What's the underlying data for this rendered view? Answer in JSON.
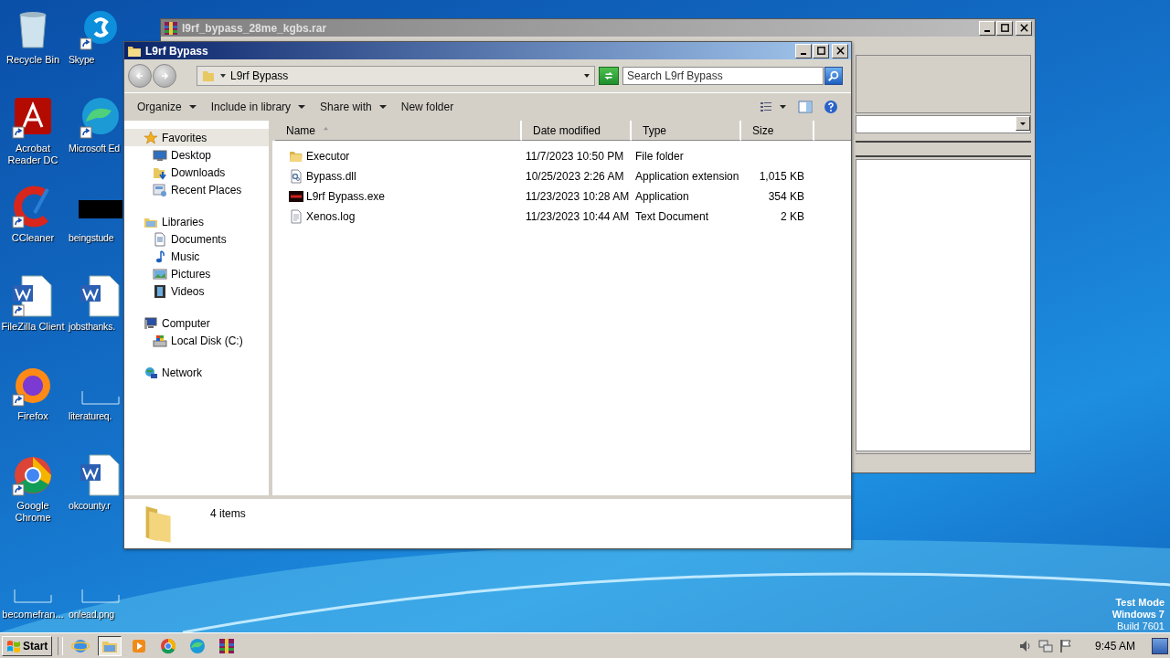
{
  "desktop": {
    "icons": [
      {
        "label": "Recycle Bin",
        "shortcut": false
      },
      {
        "label": "Skype",
        "shortcut": true
      },
      {
        "label": "Acrobat Reader DC",
        "shortcut": true
      },
      {
        "label": "Microsoft Ed",
        "shortcut": true
      },
      {
        "label": "CCleaner",
        "shortcut": true
      },
      {
        "label": "beingstude",
        "shortcut": false
      },
      {
        "label": "FileZilla Client",
        "shortcut": true
      },
      {
        "label": "jobsthanks.",
        "shortcut": false
      },
      {
        "label": "Firefox",
        "shortcut": true
      },
      {
        "label": "literatureq.",
        "shortcut": false
      },
      {
        "label": "Google Chrome",
        "shortcut": true
      },
      {
        "label": "okcounty.r",
        "shortcut": false
      },
      {
        "label": "becomefran...",
        "shortcut": false
      },
      {
        "label": "onlead.png",
        "shortcut": false
      }
    ],
    "watermark_lines": [
      "Test Mode",
      "Windows 7",
      "Build 7601"
    ]
  },
  "archive_window": {
    "title": "l9rf_bypass_28me_kgbs.rar",
    "active": false
  },
  "explorer_window": {
    "title": "L9rf Bypass",
    "active": true,
    "address": "L9rf Bypass",
    "search": {
      "placeholder": "Search L9rf Bypass"
    },
    "toolbar": [
      {
        "label": "Organize",
        "menu": true
      },
      {
        "label": "Include in library",
        "menu": true
      },
      {
        "label": "Share with",
        "menu": true
      },
      {
        "label": "New folder",
        "menu": false
      }
    ],
    "navigation": [
      {
        "label": "Favorites",
        "selected": true,
        "children": [
          {
            "label": "Desktop",
            "selected": false
          },
          {
            "label": "Downloads",
            "selected": false
          },
          {
            "label": "Recent Places",
            "selected": false
          }
        ]
      },
      {
        "label": "Libraries",
        "selected": false,
        "children": [
          {
            "label": "Documents",
            "selected": false
          },
          {
            "label": "Music",
            "selected": false
          },
          {
            "label": "Pictures",
            "selected": false
          },
          {
            "label": "Videos",
            "selected": false
          }
        ]
      },
      {
        "label": "Computer",
        "selected": false,
        "children": [
          {
            "label": "Local Disk (C:)",
            "selected": false
          }
        ]
      },
      {
        "label": "Network",
        "selected": false
      }
    ],
    "columns": [
      {
        "label": "Name",
        "sorted": true
      },
      {
        "label": "Date modified",
        "sorted": false
      },
      {
        "label": "Type",
        "sorted": false
      },
      {
        "label": "Size",
        "sorted": false
      }
    ],
    "files": [
      {
        "name": "Executor",
        "date_modified": "11/7/2023 10:50 PM",
        "type": "File folder"
      },
      {
        "name": "Bypass.dll",
        "date_modified": "10/25/2023 2:26 AM",
        "type": "Application extension",
        "size": "1,015 KB"
      },
      {
        "name": "L9rf Bypass.exe",
        "date_modified": "11/23/2023 10:28 AM",
        "type": "Application",
        "size": "354 KB"
      },
      {
        "name": "Xenos.log",
        "date_modified": "11/23/2023 10:44 AM",
        "type": "Text Document",
        "size": "2 KB"
      }
    ],
    "status": "4 items"
  },
  "taskbar": {
    "start": "Start",
    "apps": [
      {
        "selected": false
      },
      {
        "selected": true
      },
      {
        "selected": false
      },
      {
        "selected": false
      },
      {
        "selected": false
      },
      {
        "selected": false
      }
    ],
    "clock": "9:45 AM"
  }
}
